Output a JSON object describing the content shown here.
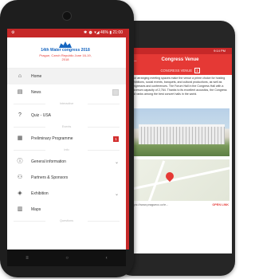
{
  "front": {
    "status": {
      "left": "⚙",
      "right": "✱ ⏰ ▾◢ 46% ▮ 21:00"
    },
    "logo": {
      "title": "14th Water congress 2018",
      "subtitle": "Prague, Czech Republic\nJune 16-19, 2018"
    },
    "menu": [
      {
        "type": "item",
        "label": "Home",
        "icon": "home-icon",
        "active": true
      },
      {
        "type": "item",
        "label": "News",
        "icon": "news-icon",
        "badge": "grey"
      },
      {
        "type": "section",
        "label": "Interactive"
      },
      {
        "type": "item",
        "label": "Quiz - USA",
        "icon": "quiz-icon"
      },
      {
        "type": "section",
        "label": "Events"
      },
      {
        "type": "item",
        "label": "Preliminary Programme",
        "icon": "calendar-icon",
        "badge": "red",
        "badge_text": "1"
      },
      {
        "type": "section",
        "label": "Info"
      },
      {
        "type": "item",
        "label": "General information",
        "icon": "info-icon",
        "chevron": true
      },
      {
        "type": "item",
        "label": "Partners & Sponsors",
        "icon": "partners-icon"
      },
      {
        "type": "item",
        "label": "Exhibition",
        "icon": "exhibition-icon",
        "chevron": true
      },
      {
        "type": "item",
        "label": "Maps",
        "icon": "map-icon"
      },
      {
        "type": "section",
        "label": "Questions"
      }
    ],
    "nav": {
      "back": "≡",
      "home": "○",
      "recent": "‹"
    }
  },
  "back": {
    "status": "9:14 PM",
    "title": "Congress Venue",
    "tab_label": "CONGRESS VENUE",
    "tab_count": "1",
    "text": "...for arranging meeting spaces make the venue a prime choice for hosting exhibitions, social events, banquets, and cultural productions, as well as congresses and conferences. The Forum Hall in the Congress Hall with a maximum capacity of 2,764. Thanks to its excellent acoustics, the Congress Hall ranks among the best concert halls in the world.",
    "link": "https://www.praguecc.cz/e...",
    "open_link": "OPEN LINK"
  },
  "colors": {
    "accent": "#e53935",
    "status": "#c62828",
    "logo": "#1565c0"
  }
}
